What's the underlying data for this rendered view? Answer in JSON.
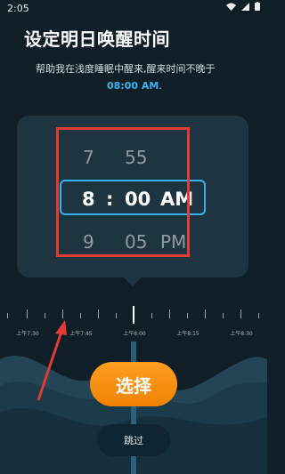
{
  "status_bar": {
    "time": "2:05"
  },
  "page_title": "设定明日唤醒时间",
  "subtitle": {
    "line": "帮助我在浅度睡眠中醒来,醒来时间不晚于",
    "time": "08:00 AM",
    "suffix": "."
  },
  "picker": {
    "rows": [
      {
        "hour": "7",
        "minute": "55",
        "period": ""
      },
      {
        "hour": "8",
        "separator": ":",
        "minute": "00",
        "period": "AM"
      },
      {
        "hour": "9",
        "minute": "05",
        "period": "PM"
      }
    ]
  },
  "timeline": {
    "labels": [
      "上午7:30",
      "上午7:45",
      "上午8:00",
      "上午8:15",
      "上午8:30"
    ]
  },
  "buttons": {
    "select": "选择",
    "skip": "跳过"
  },
  "colors": {
    "accent": "#38b2ee",
    "primary_button": "#f58f12",
    "annotation": "#e23b34"
  }
}
